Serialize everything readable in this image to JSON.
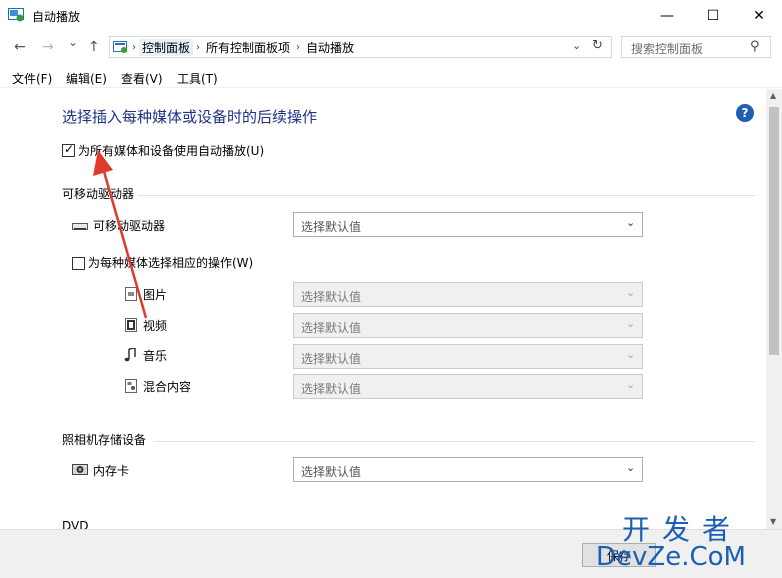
{
  "window": {
    "title": "自动播放",
    "min_glyph": "—",
    "max_glyph": "☐",
    "close_glyph": "✕"
  },
  "nav": {
    "back_glyph": "←",
    "forward_glyph": "→",
    "recent_glyph": "⌄",
    "up_glyph": "↑",
    "breadcrumbs": [
      "控制面板",
      "所有控制面板项",
      "自动播放"
    ],
    "separator": "›",
    "dropdown_glyph": "⌄",
    "refresh_glyph": "↻",
    "search_placeholder": "搜索控制面板",
    "search_glyph": "⚲"
  },
  "menu": {
    "file": "文件(F)",
    "edit": "编辑(E)",
    "view": "查看(V)",
    "tools": "工具(T)"
  },
  "content": {
    "heading": "选择插入每种媒体或设备时的后续操作",
    "help_glyph": "?",
    "autoplay_all_label": "为所有媒体和设备使用自动播放(U)",
    "autoplay_all_checked": true,
    "check_glyph": "✓",
    "removable_section": "可移动驱动器",
    "removable_drive_label": "可移动驱动器",
    "removable_drive_value": "选择默认值",
    "per_media_label": "为每种媒体选择相应的操作(W)",
    "per_media_checked": false,
    "media_items": [
      {
        "label": "图片",
        "value": "选择默认值"
      },
      {
        "label": "视频",
        "value": "选择默认值"
      },
      {
        "label": "音乐",
        "value": "选择默认值"
      },
      {
        "label": "混合内容",
        "value": "选择默认值"
      }
    ],
    "camera_section": "照相机存储设备",
    "memory_card_label": "内存卡",
    "memory_card_value": "选择默认值",
    "dvd_section": "DVD",
    "select_arrow": "⌄"
  },
  "scroll": {
    "up_glyph": "▲",
    "down_glyph": "▼"
  },
  "footer": {
    "save_label": "保存"
  },
  "watermark": {
    "top": "开发者",
    "bottom": "DevZe.CoM"
  },
  "colors": {
    "heading": "#1e3287",
    "annotation_arrow": "#e03a2c",
    "watermark": "#1a5fb4"
  },
  "icons": {
    "window": "autoplay-window-icon",
    "breadcrumb_root": "control-panel-icon",
    "drive": "removable-drive-icon",
    "picture": "picture-file-icon",
    "video": "video-file-icon",
    "music": "music-note-icon",
    "mixed": "mixed-content-icon",
    "memory_card": "memory-card-icon"
  }
}
